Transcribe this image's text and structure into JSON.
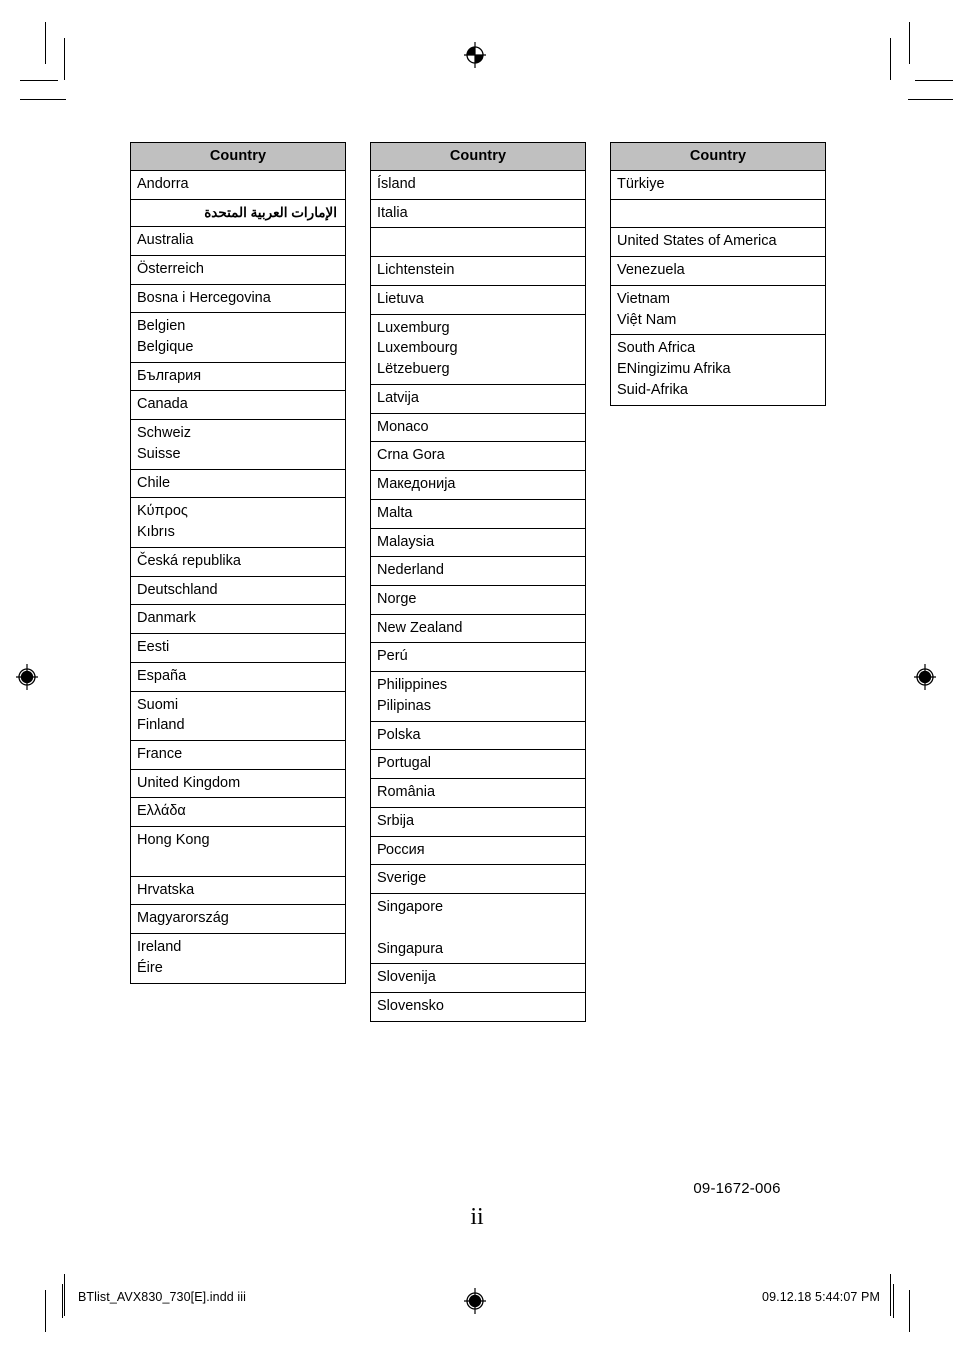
{
  "page": {
    "page_number": "ii",
    "document_code": "09-1672-006",
    "footer_left": "BTlist_AVX830_730[E].indd   iii",
    "footer_right": "09.12.18   5:44:07 PM",
    "header_label": "Country",
    "header_bg": "#c0c0c0",
    "border_color": "#000000",
    "text_color": "#000000"
  },
  "columns": [
    {
      "id": "column-1",
      "header": "Country",
      "rows": [
        {
          "text": "Andorra",
          "rtl": false,
          "thick_top": false
        },
        {
          "text": "الإمارات العربية المتحدة",
          "rtl": true,
          "thick_top": true
        },
        {
          "text": "Australia",
          "rtl": false,
          "thick_top": false
        },
        {
          "text": "Österreich",
          "rtl": false,
          "thick_top": false
        },
        {
          "text": "Bosna i Hercegovina",
          "rtl": false,
          "thick_top": false
        },
        {
          "text": "Belgien\nBelgique",
          "rtl": false,
          "thick_top": false
        },
        {
          "text": "България",
          "rtl": false,
          "thick_top": true
        },
        {
          "text": "Canada",
          "rtl": false,
          "thick_top": false
        },
        {
          "text": "Schweiz\nSuisse",
          "rtl": false,
          "thick_top": false
        },
        {
          "text": "Chile",
          "rtl": false,
          "thick_top": false
        },
        {
          "text": "Κύπρος\nKıbrıs",
          "rtl": false,
          "thick_top": false
        },
        {
          "text": "Česká republika",
          "rtl": false,
          "thick_top": false
        },
        {
          "text": "Deutschland",
          "rtl": false,
          "thick_top": false
        },
        {
          "text": "Danmark",
          "rtl": false,
          "thick_top": false
        },
        {
          "text": "Eesti",
          "rtl": false,
          "thick_top": false
        },
        {
          "text": "España",
          "rtl": false,
          "thick_top": false
        },
        {
          "text": "Suomi\nFinland",
          "rtl": false,
          "thick_top": true
        },
        {
          "text": "France",
          "rtl": false,
          "thick_top": false
        },
        {
          "text": "United Kingdom",
          "rtl": false,
          "thick_top": false
        },
        {
          "text": "Ελλάδα",
          "rtl": false,
          "thick_top": false
        },
        {
          "text": "Hong Kong\n\n",
          "rtl": false,
          "thick_top": false
        },
        {
          "text": "Hrvatska",
          "rtl": false,
          "thick_top": false
        },
        {
          "text": "Magyarország",
          "rtl": false,
          "thick_top": false
        },
        {
          "text": "Ireland\nÉire",
          "rtl": false,
          "thick_top": false
        }
      ]
    },
    {
      "id": "column-2",
      "header": "Country",
      "rows": [
        {
          "text": "Ísland",
          "rtl": false,
          "thick_top": false
        },
        {
          "text": "Italia",
          "rtl": false,
          "thick_top": true
        },
        {
          "text": "",
          "rtl": false,
          "thick_top": false
        },
        {
          "text": "Lichtenstein",
          "rtl": false,
          "thick_top": true
        },
        {
          "text": "Lietuva",
          "rtl": false,
          "thick_top": false
        },
        {
          "text": "Luxemburg\nLuxembourg\nLëtzebuerg",
          "rtl": false,
          "thick_top": false
        },
        {
          "text": "Latvija",
          "rtl": false,
          "thick_top": false
        },
        {
          "text": "Monaco",
          "rtl": false,
          "thick_top": false
        },
        {
          "text": "Crna Gora",
          "rtl": false,
          "thick_top": false
        },
        {
          "text": "Македонија",
          "rtl": false,
          "thick_top": false
        },
        {
          "text": "Malta",
          "rtl": false,
          "thick_top": false
        },
        {
          "text": "Malaysia",
          "rtl": false,
          "thick_top": false
        },
        {
          "text": "Nederland",
          "rtl": false,
          "thick_top": false
        },
        {
          "text": "Norge",
          "rtl": false,
          "thick_top": true
        },
        {
          "text": "New Zealand",
          "rtl": false,
          "thick_top": false
        },
        {
          "text": "Perú",
          "rtl": false,
          "thick_top": false
        },
        {
          "text": "Philippines\nPilipinas",
          "rtl": false,
          "thick_top": false
        },
        {
          "text": "Polska",
          "rtl": false,
          "thick_top": false
        },
        {
          "text": "Portugal",
          "rtl": false,
          "thick_top": true
        },
        {
          "text": "România",
          "rtl": false,
          "thick_top": false
        },
        {
          "text": "Srbija",
          "rtl": false,
          "thick_top": false
        },
        {
          "text": "Россия",
          "rtl": false,
          "thick_top": false
        },
        {
          "text": "Sverige",
          "rtl": false,
          "thick_top": false
        },
        {
          "text": "Singapore\n\nSingapura",
          "rtl": false,
          "thick_top": false
        },
        {
          "text": "Slovenija",
          "rtl": false,
          "thick_top": false
        },
        {
          "text": "Slovensko",
          "rtl": false,
          "thick_top": false
        }
      ]
    },
    {
      "id": "column-3",
      "header": "Country",
      "rows": [
        {
          "text": "Türkiye",
          "rtl": false,
          "thick_top": false
        },
        {
          "text": "",
          "rtl": false,
          "thick_top": true
        },
        {
          "text": "United States of America",
          "rtl": false,
          "thick_top": true
        },
        {
          "text": "Venezuela",
          "rtl": false,
          "thick_top": false
        },
        {
          "text": "Vietnam\nViệt Nam",
          "rtl": false,
          "thick_top": false
        },
        {
          "text": "South Africa\nENingizimu Afrika\nSuid-Afrika",
          "rtl": false,
          "thick_top": true
        }
      ]
    }
  ],
  "marks": {
    "registration_icon": "registration-target-icon",
    "crop_mark": "crop-mark"
  }
}
